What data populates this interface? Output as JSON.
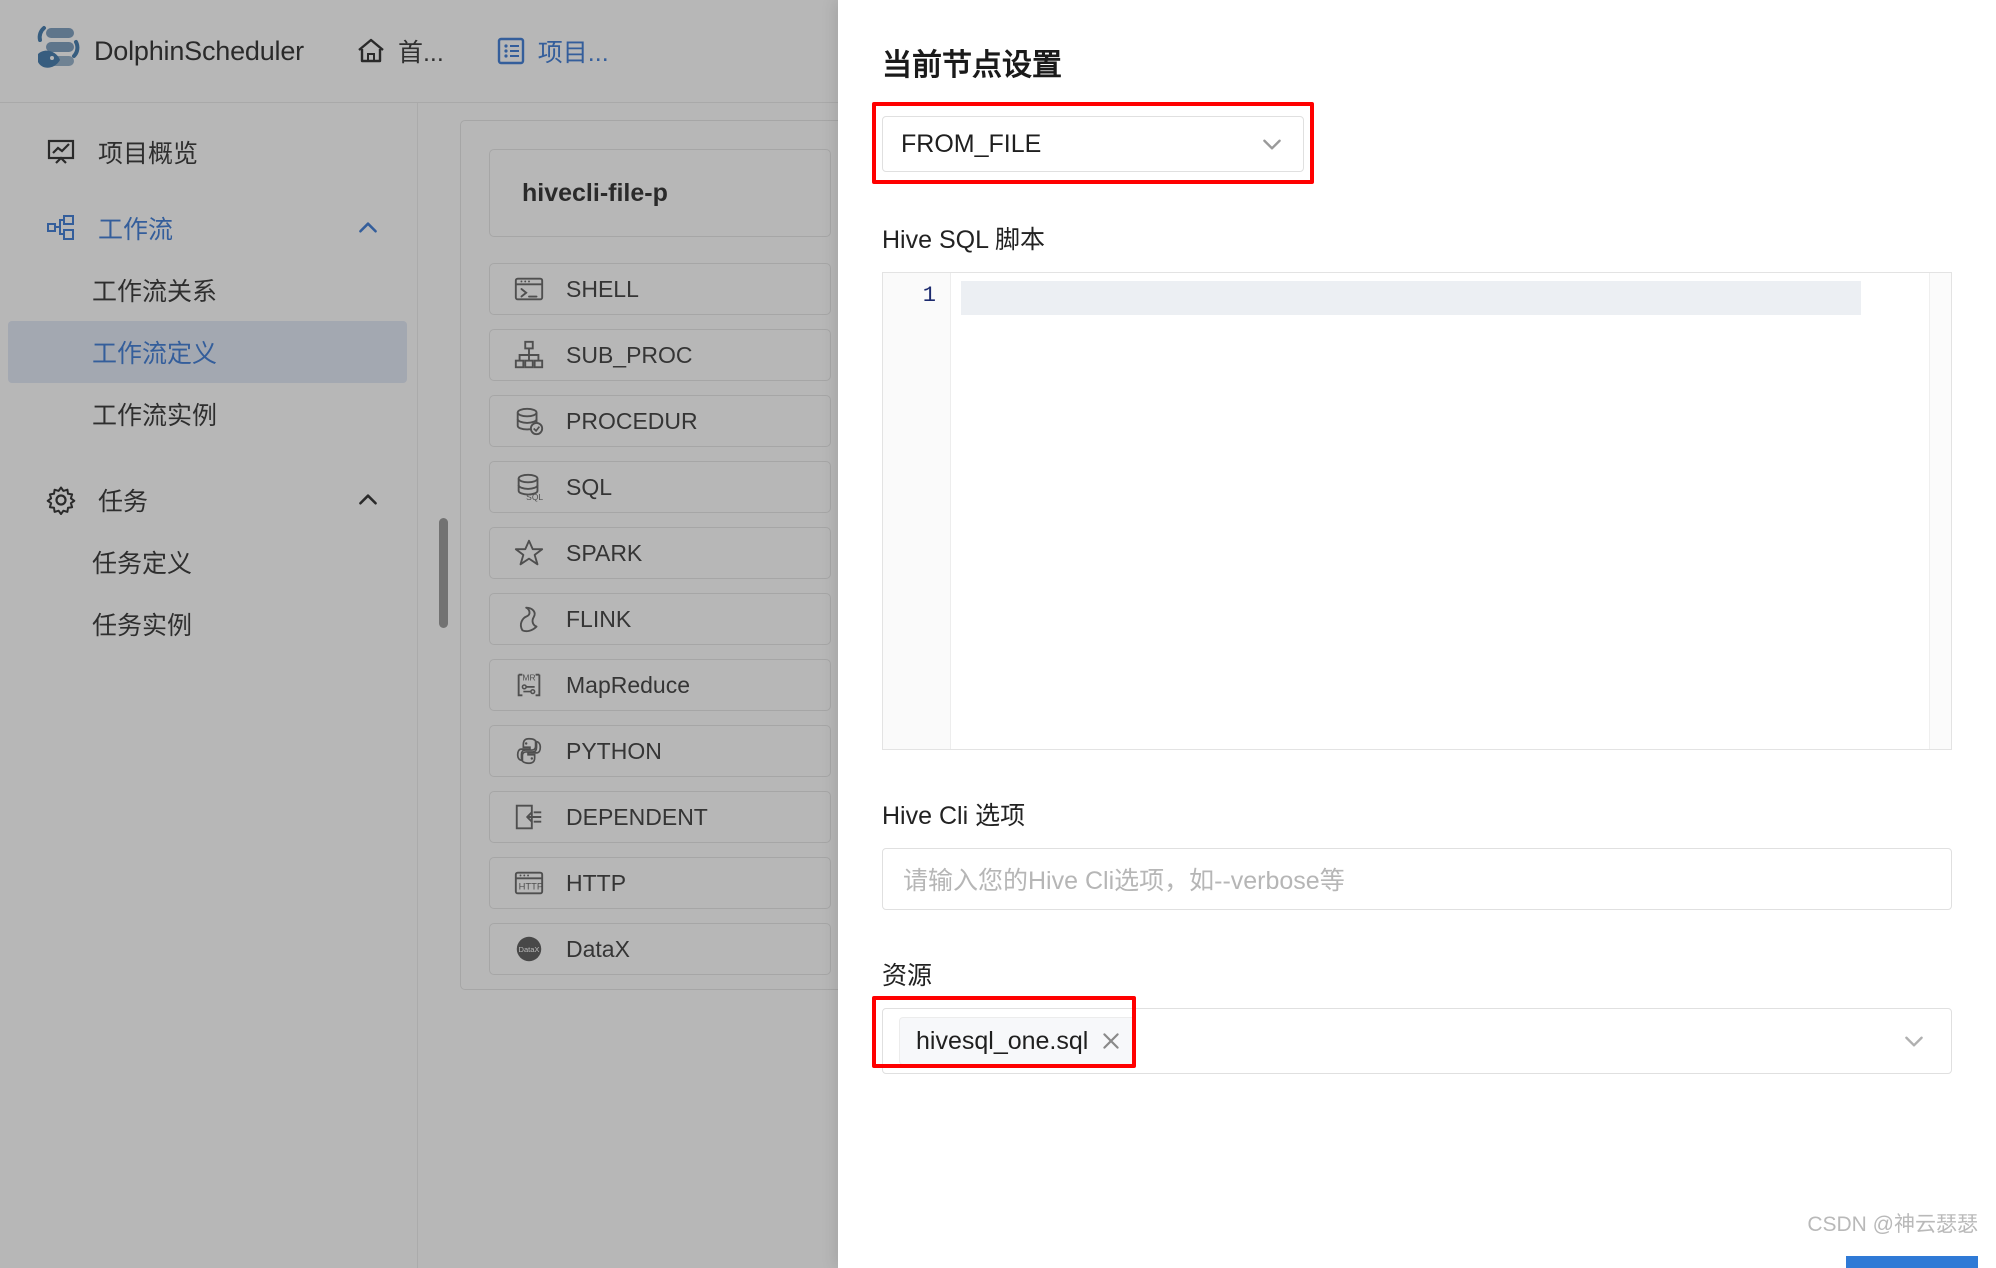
{
  "header": {
    "brand": "DolphinScheduler",
    "nav": [
      {
        "label": "首...",
        "icon": "home-icon",
        "active": false
      },
      {
        "label": "项目...",
        "icon": "list-icon",
        "active": true
      }
    ]
  },
  "sidebar": {
    "items": [
      {
        "label": "项目概览",
        "icon": "overview-icon",
        "type": "root",
        "blue": false,
        "chevron": null
      },
      {
        "label": "工作流",
        "icon": "workflow-icon",
        "type": "root",
        "blue": true,
        "chevron": "chevron-up-icon"
      },
      {
        "label": "工作流关系",
        "type": "sub",
        "selected": false
      },
      {
        "label": "工作流定义",
        "type": "sub",
        "selected": true
      },
      {
        "label": "工作流实例",
        "type": "sub",
        "selected": false
      },
      {
        "label": "任务",
        "icon": "gear-icon",
        "type": "root",
        "blue": false,
        "chevron": "chevron-up-icon"
      },
      {
        "label": "任务定义",
        "type": "sub",
        "selected": false
      },
      {
        "label": "任务实例",
        "type": "sub",
        "selected": false
      }
    ]
  },
  "canvas": {
    "workflow_name": "hivecli-file-p",
    "tasks": [
      {
        "label": "SHELL",
        "icon": "terminal-icon"
      },
      {
        "label": "SUB_PROC",
        "icon": "sub-process-icon"
      },
      {
        "label": "PROCEDUR",
        "icon": "procedure-icon"
      },
      {
        "label": "SQL",
        "icon": "sql-icon"
      },
      {
        "label": "SPARK",
        "icon": "spark-icon"
      },
      {
        "label": "FLINK",
        "icon": "flink-icon"
      },
      {
        "label": "MapReduce",
        "icon": "mapreduce-icon"
      },
      {
        "label": "PYTHON",
        "icon": "python-icon"
      },
      {
        "label": "DEPENDENT",
        "icon": "dependent-icon"
      },
      {
        "label": "HTTP",
        "icon": "http-icon"
      },
      {
        "label": "DataX",
        "icon": "datax-icon"
      }
    ]
  },
  "drawer": {
    "title": "当前节点设置",
    "source_select": {
      "value": "FROM_FILE",
      "icon": "chevron-down-icon",
      "highlight_color": "#ff0000"
    },
    "script": {
      "label": "Hive SQL 脚本",
      "line_numbers": [
        "1"
      ],
      "content": ""
    },
    "cli_options": {
      "label": "Hive Cli 选项",
      "placeholder": "请输入您的Hive Cli选项，如--verbose等",
      "value": ""
    },
    "resources": {
      "label": "资源",
      "tags": [
        {
          "name": "hivesql_one.sql",
          "remove_icon": "close-icon"
        }
      ],
      "icon": "chevron-down-icon",
      "highlight_color": "#ff0000"
    }
  },
  "watermark": "CSDN @神云瑟瑟"
}
